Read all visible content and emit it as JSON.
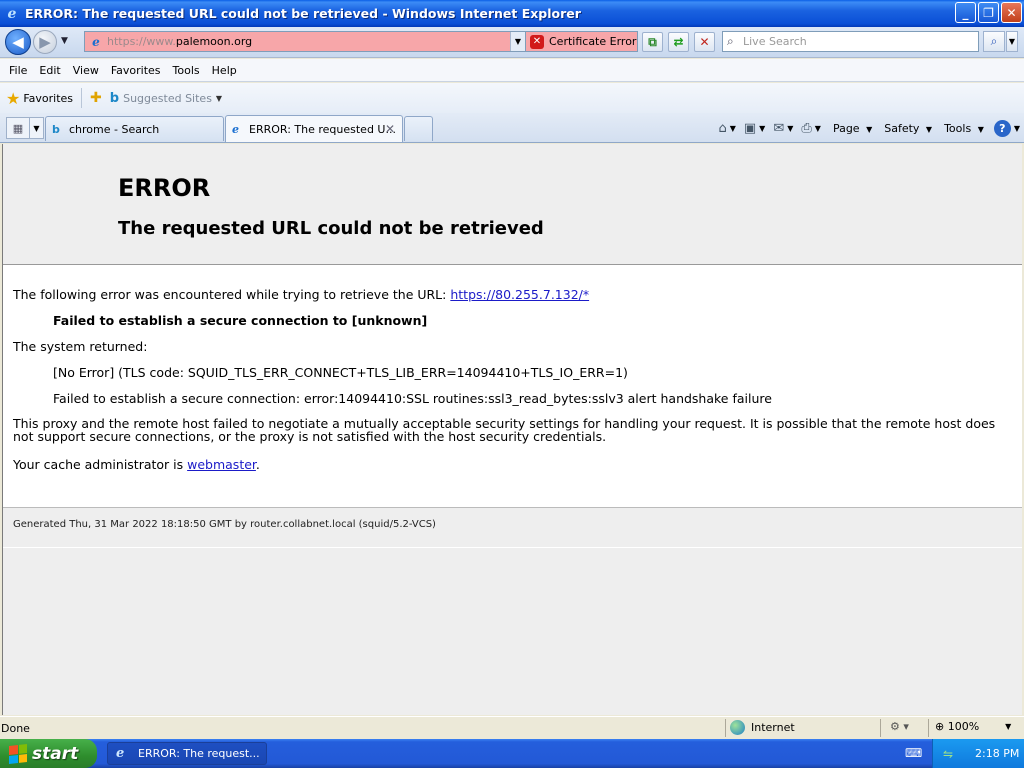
{
  "window": {
    "title": "ERROR: The requested URL could not be retrieved - Windows Internet Explorer",
    "controls": {
      "minimize": "_",
      "maximize": "❐",
      "close": "✕"
    }
  },
  "address_bar": {
    "url_scheme": "https://www.",
    "url_domain": "palemoon.org",
    "cert_error_label": "Certificate Error",
    "search_placeholder": "Live Search",
    "colors": {
      "error_bg": "#f7a6a9"
    }
  },
  "menu": [
    "File",
    "Edit",
    "View",
    "Favorites",
    "Tools",
    "Help"
  ],
  "favorites_bar": {
    "favorites_label": "Favorites",
    "suggested_sites_label": "Suggested Sites"
  },
  "tabs": [
    {
      "label": "chrome - Search",
      "icon": "bing-icon",
      "active": false
    },
    {
      "label": "ERROR: The requested U...",
      "icon": "ie-page-icon",
      "active": true
    }
  ],
  "command_bar": {
    "page_label": "Page",
    "safety_label": "Safety",
    "tools_label": "Tools"
  },
  "page": {
    "heading": "ERROR",
    "subheading": "The requested URL could not be retrieved",
    "intro_text": "The following error was encountered while trying to retrieve the URL: ",
    "error_url": "https://80.255.7.132/*",
    "failure_title": "Failed to establish a secure connection to [unknown]",
    "system_returned": "The system returned:",
    "tls_code": "[No Error] (TLS code: SQUID_TLS_ERR_CONNECT+TLS_LIB_ERR=14094410+TLS_IO_ERR=1)",
    "ssl_error": "Failed to establish a secure connection: error:14094410:SSL routines:ssl3_read_bytes:sslv3 alert handshake failure",
    "explanation": "This proxy and the remote host failed to negotiate a mutually acceptable security settings for handling your request. It is possible that the remote host does not support secure connections, or the proxy is not satisfied with the host security credentials.",
    "admin_prefix": "Your cache administrator is ",
    "admin_link": "webmaster",
    "admin_suffix": ".",
    "footer": "Generated Thu, 31 Mar 2022 18:18:50 GMT by router.collabnet.local (squid/5.2-VCS)"
  },
  "status_bar": {
    "status": "Done",
    "zone": "Internet",
    "zoom": "100%"
  },
  "taskbar": {
    "start_label": "start",
    "window_item": "ERROR: The request...",
    "clock": "2:18 PM"
  }
}
